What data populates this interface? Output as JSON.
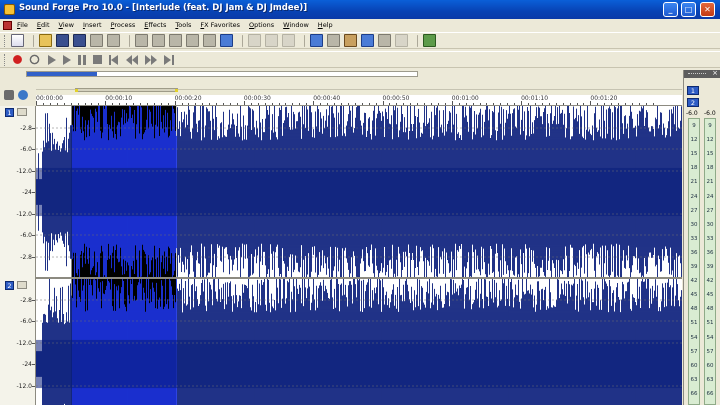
{
  "window": {
    "title": "Sound Forge Pro 10.0 - [Interlude (feat. DJ Jam & DJ Jmdee)]",
    "minimize": "_",
    "maximize": "□",
    "close": "✕"
  },
  "menu": [
    "File",
    "Edit",
    "View",
    "Insert",
    "Process",
    "Effects",
    "Tools",
    "FX Favorites",
    "Options",
    "Window",
    "Help"
  ],
  "transport": {
    "position_fraction": 0.18
  },
  "overview": {
    "selection_start_fraction": 0.06,
    "selection_end_fraction": 0.22
  },
  "ruler": {
    "labels": [
      "00:00:00",
      "00:00:10",
      "00:00:20",
      "00:00:30",
      "00:00:40",
      "00:00:50",
      "00:01:00",
      "00:01:10",
      "00:01:20"
    ]
  },
  "channels": [
    {
      "number": "1",
      "scale": [
        "-2.8",
        "-6.0",
        "-12.0",
        "-24",
        "-12.0",
        "-6.0",
        "-2.8"
      ]
    },
    {
      "number": "2",
      "scale": [
        "-2.8",
        "-6.0",
        "-12.0",
        "-24",
        "-12.0"
      ]
    }
  ],
  "selection": {
    "start_fraction": 0.055,
    "end_fraction": 0.217
  },
  "meter": {
    "channels": [
      "1",
      "2"
    ],
    "values": [
      "-6.0",
      "-6.0"
    ],
    "scale": [
      "9",
      "12",
      "15",
      "18",
      "21",
      "24",
      "27",
      "30",
      "33",
      "36",
      "39",
      "42",
      "45",
      "48",
      "51",
      "54",
      "57",
      "60",
      "63",
      "66"
    ]
  },
  "colors": {
    "waveform": "#081c7a",
    "waveform_selected": "#1d35e6",
    "selection_bg": "#000000",
    "background": "#ffffff"
  }
}
